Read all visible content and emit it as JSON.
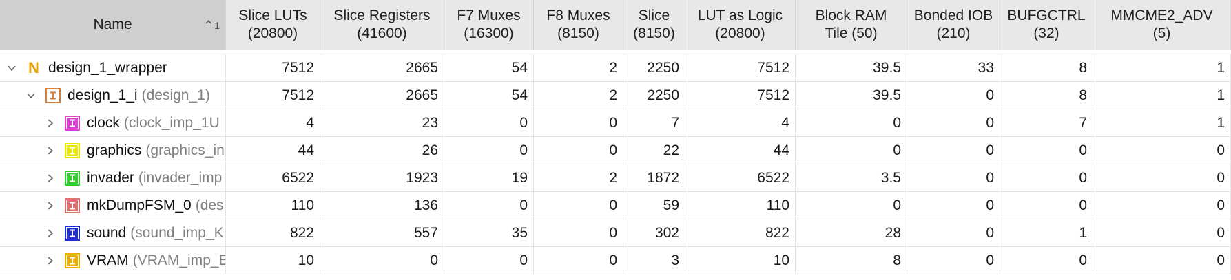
{
  "header": {
    "name_label": "Name",
    "sort_number": "1",
    "columns": [
      {
        "label": "Slice LUTs",
        "sub": "(20800)"
      },
      {
        "label": "Slice Registers",
        "sub": "(41600)"
      },
      {
        "label": "F7 Muxes",
        "sub": "(16300)"
      },
      {
        "label": "F8 Muxes",
        "sub": "(8150)"
      },
      {
        "label": "Slice",
        "sub": "(8150)"
      },
      {
        "label": "LUT as Logic",
        "sub": "(20800)"
      },
      {
        "label": "Block RAM",
        "sub": "Tile (50)"
      },
      {
        "label": "Bonded IOB",
        "sub": "(210)"
      },
      {
        "label": "BUFGCTRL",
        "sub": "(32)"
      },
      {
        "label": "MMCME2_ADV",
        "sub": "(5)"
      }
    ]
  },
  "rows": [
    {
      "name": "design_1_wrapper",
      "sub": "",
      "icon": "top-module-icon",
      "icon_color": "#e6a100",
      "expanded": true,
      "values": [
        "7512",
        "2665",
        "54",
        "2",
        "2250",
        "7512",
        "39.5",
        "33",
        "8",
        "1"
      ]
    },
    {
      "name": "design_1_i",
      "sub": "(design_1)",
      "icon": "module-icon",
      "icon_color": "#d08040",
      "expanded": true,
      "values": [
        "7512",
        "2665",
        "54",
        "2",
        "2250",
        "7512",
        "39.5",
        "0",
        "8",
        "1"
      ]
    },
    {
      "name": "clock",
      "sub": "(clock_imp_1U",
      "icon": "module-icon",
      "icon_color": "#e040d0",
      "expanded": false,
      "values": [
        "4",
        "23",
        "0",
        "0",
        "7",
        "4",
        "0",
        "0",
        "7",
        "1"
      ]
    },
    {
      "name": "graphics",
      "sub": "(graphics_in",
      "icon": "module-icon",
      "icon_color": "#e8e800",
      "expanded": false,
      "values": [
        "44",
        "26",
        "0",
        "0",
        "22",
        "44",
        "0",
        "0",
        "0",
        "0"
      ]
    },
    {
      "name": "invader",
      "sub": "(invader_imp",
      "icon": "module-icon",
      "icon_color": "#30d030",
      "expanded": false,
      "values": [
        "6522",
        "1923",
        "19",
        "2",
        "1872",
        "6522",
        "3.5",
        "0",
        "0",
        "0"
      ]
    },
    {
      "name": "mkDumpFSM_0",
      "sub": "(des",
      "icon": "module-icon",
      "icon_color": "#e07070",
      "expanded": false,
      "values": [
        "110",
        "136",
        "0",
        "0",
        "59",
        "110",
        "0",
        "0",
        "0",
        "0"
      ]
    },
    {
      "name": "sound",
      "sub": "(sound_imp_K",
      "icon": "module-icon",
      "icon_color": "#2030d0",
      "expanded": false,
      "values": [
        "822",
        "557",
        "35",
        "0",
        "302",
        "822",
        "28",
        "0",
        "1",
        "0"
      ]
    },
    {
      "name": "VRAM",
      "sub": "(VRAM_imp_E",
      "icon": "module-icon",
      "icon_color": "#e8b000",
      "expanded": false,
      "values": [
        "10",
        "0",
        "0",
        "0",
        "3",
        "10",
        "8",
        "0",
        "0",
        "0"
      ]
    }
  ]
}
